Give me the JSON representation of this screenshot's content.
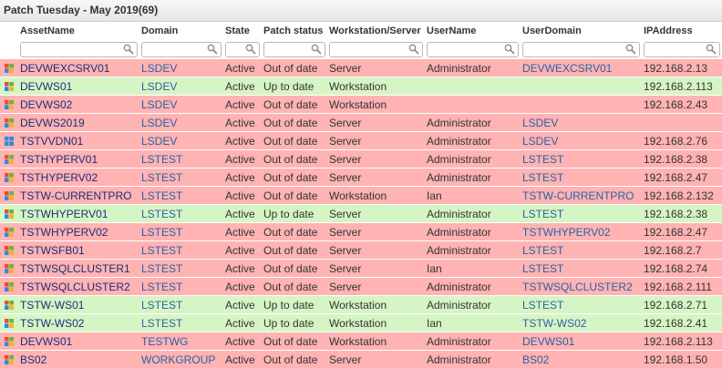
{
  "title": "Patch Tuesday - May 2019(69)",
  "columns": [
    "AssetName",
    "Domain",
    "State",
    "Patch status",
    "Workstation/Server",
    "UserName",
    "UserDomain",
    "IPAddress"
  ],
  "rows": [
    {
      "icon": "windows-logo-icon",
      "status": "red",
      "cells": [
        "DEVWEXCSRV01",
        "LSDEV",
        "Active",
        "Out of date",
        "Server",
        "Administrator",
        "DEVWEXCSRV01",
        "192.168.2.13"
      ]
    },
    {
      "icon": "windows-logo-icon",
      "status": "green",
      "cells": [
        "DEVWS01",
        "LSDEV",
        "Active",
        "Up to date",
        "Workstation",
        "",
        "",
        "192.168.2.113"
      ]
    },
    {
      "icon": "windows-logo-icon",
      "status": "red",
      "cells": [
        "DEVWS02",
        "LSDEV",
        "Active",
        "Out of date",
        "Workstation",
        "",
        "",
        "192.168.2.43"
      ]
    },
    {
      "icon": "windows-logo-icon",
      "status": "red",
      "cells": [
        "DEVWS2019",
        "LSDEV",
        "Active",
        "Out of date",
        "Server",
        "Administrator",
        "LSDEV",
        ""
      ]
    },
    {
      "icon": "windows10-logo-icon",
      "status": "red",
      "cells": [
        "TSTVVDN01",
        "LSDEV",
        "Active",
        "Out of date",
        "Server",
        "Administrator",
        "LSDEV",
        "192.168.2.76"
      ]
    },
    {
      "icon": "windows-logo-icon",
      "status": "red",
      "cells": [
        "TSTHYPERV01",
        "LSTEST",
        "Active",
        "Out of date",
        "Server",
        "Administrator",
        "LSTEST",
        "192.168.2.38"
      ]
    },
    {
      "icon": "windows-logo-icon",
      "status": "red",
      "cells": [
        "TSTHYPERV02",
        "LSTEST",
        "Active",
        "Out of date",
        "Server",
        "Administrator",
        "LSTEST",
        "192.168.2.47"
      ]
    },
    {
      "icon": "windows-logo-icon",
      "status": "red",
      "cells": [
        "TSTW-CURRENTPRO",
        "LSTEST",
        "Active",
        "Out of date",
        "Workstation",
        "Ian",
        "TSTW-CURRENTPRO",
        "192.168.2.132"
      ]
    },
    {
      "icon": "windows-logo-icon",
      "status": "green",
      "cells": [
        "TSTWHYPERV01",
        "LSTEST",
        "Active",
        "Up to date",
        "Server",
        "Administrator",
        "LSTEST",
        "192.168.2.38"
      ]
    },
    {
      "icon": "windows-logo-icon",
      "status": "red",
      "cells": [
        "TSTWHYPERV02",
        "LSTEST",
        "Active",
        "Out of date",
        "Server",
        "Administrator",
        "TSTWHYPERV02",
        "192.168.2.47"
      ]
    },
    {
      "icon": "windows-logo-icon",
      "status": "red",
      "cells": [
        "TSTWSFB01",
        "LSTEST",
        "Active",
        "Out of date",
        "Server",
        "Administrator",
        "LSTEST",
        "192.168.2.7"
      ]
    },
    {
      "icon": "windows-logo-icon",
      "status": "red",
      "cells": [
        "TSTWSQLCLUSTER1",
        "LSTEST",
        "Active",
        "Out of date",
        "Server",
        "Ian",
        "LSTEST",
        "192.168.2.74"
      ]
    },
    {
      "icon": "windows-logo-icon",
      "status": "red",
      "cells": [
        "TSTWSQLCLUSTER2",
        "LSTEST",
        "Active",
        "Out of date",
        "Server",
        "Administrator",
        "TSTWSQLCLUSTER2",
        "192.168.2.111"
      ]
    },
    {
      "icon": "windows-logo-icon",
      "status": "green",
      "cells": [
        "TSTW-WS01",
        "LSTEST",
        "Active",
        "Up to date",
        "Workstation",
        "Administrator",
        "LSTEST",
        "192.168.2.71"
      ]
    },
    {
      "icon": "windows-logo-icon",
      "status": "green",
      "cells": [
        "TSTW-WS02",
        "LSTEST",
        "Active",
        "Up to date",
        "Workstation",
        "Ian",
        "TSTW-WS02",
        "192.168.2.41"
      ]
    },
    {
      "icon": "windows-logo-icon",
      "status": "red",
      "cells": [
        "DEVWS01",
        "TESTWG",
        "Active",
        "Out of date",
        "Workstation",
        "Administrator",
        "DEVWS01",
        "192.168.2.113"
      ]
    },
    {
      "icon": "windows-logo-icon",
      "status": "red",
      "cells": [
        "BS02",
        "WORKGROUP",
        "Active",
        "Out of date",
        "Server",
        "Administrator",
        "BS02",
        "192.168.1.50"
      ]
    }
  ],
  "colors": {
    "out_of_date": "#ffb3b3",
    "up_to_date": "#d6f5c4",
    "link": "#2a62a6",
    "asset": "#1d2d7a"
  }
}
